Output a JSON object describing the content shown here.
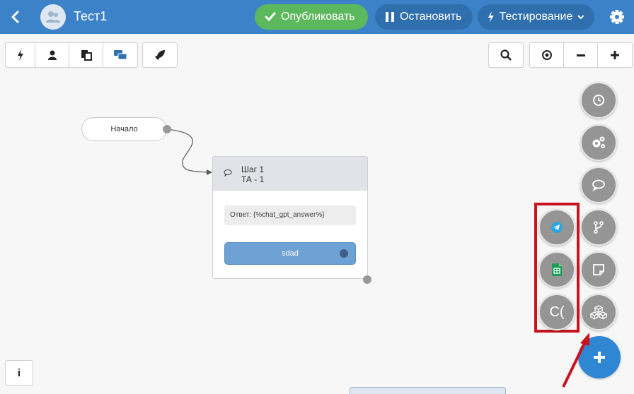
{
  "header": {
    "title": "Тест1",
    "publish_label": "Опубликовать",
    "stop_label": "Остановить",
    "testing_label": "Тестирование"
  },
  "toolbar": {
    "left_icons": [
      "lightning-icon",
      "user-icon",
      "copy-icon",
      "chat-icon"
    ],
    "launch_icon": "rocket-icon",
    "search_icon": "search-icon",
    "zoom_icons": [
      "target-icon",
      "minus-icon",
      "plus-icon"
    ]
  },
  "canvas": {
    "start_label": "Начало",
    "step": {
      "title": "Шаг 1",
      "subtitle": "ТА - 1",
      "answer": "Ответ: {%chat_gpt_answer%}",
      "button_label": "sdad"
    }
  },
  "fab_icons": {
    "right": [
      "clock-icon",
      "gears-icon",
      "comment-icon",
      "branch-icon",
      "note-icon",
      "cubes-icon"
    ],
    "left_highlighted": [
      "telegram-icon",
      "sheets-icon"
    ],
    "left_text": "C(",
    "add": "plus-icon"
  },
  "colors": {
    "header_bg": "#3c82c8",
    "publish_green": "#5cb85c",
    "highlight_red": "#c8141e",
    "fab_gray": "#959595",
    "add_blue": "#2f86d2"
  },
  "info_label": "i"
}
